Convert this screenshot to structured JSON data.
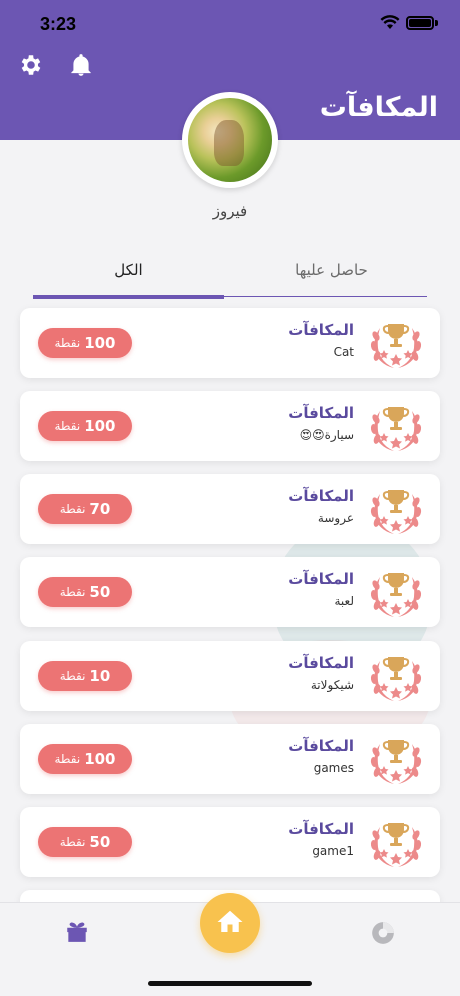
{
  "status_bar": {
    "time": "3:23"
  },
  "header": {
    "title": "المكافآت",
    "settings_icon": "gear-icon",
    "notifications_icon": "bell-icon",
    "background": "#6c56b3"
  },
  "profile": {
    "username": "فيروز"
  },
  "tabs": [
    {
      "label": "الكل",
      "active": true
    },
    {
      "label": "حاصل عليها",
      "active": false
    }
  ],
  "rewards": [
    {
      "title": "المكافآت",
      "subtitle": "Cat",
      "points": "100",
      "unit": "نقطة"
    },
    {
      "title": "المكافآت",
      "subtitle": "سيارة😍😍",
      "points": "100",
      "unit": "نقطة"
    },
    {
      "title": "المكافآت",
      "subtitle": "عروسة",
      "points": "70",
      "unit": "نقطة"
    },
    {
      "title": "المكافآت",
      "subtitle": "لعبة",
      "points": "50",
      "unit": "نقطة"
    },
    {
      "title": "المكافآت",
      "subtitle": "شيكولاتة",
      "points": "10",
      "unit": "نقطة"
    },
    {
      "title": "المكافآت",
      "subtitle": "games",
      "points": "100",
      "unit": "نقطة"
    },
    {
      "title": "المكافآت",
      "subtitle": "game1",
      "points": "50",
      "unit": "نقطة"
    }
  ],
  "colors": {
    "accent": "#6c56b3",
    "badge": "#ec7474",
    "home_button": "#f8c24e"
  },
  "bottom_nav": {
    "items": [
      {
        "icon": "gift-icon"
      },
      {
        "icon": "home-icon"
      },
      {
        "icon": "pie-chart-icon"
      }
    ]
  }
}
